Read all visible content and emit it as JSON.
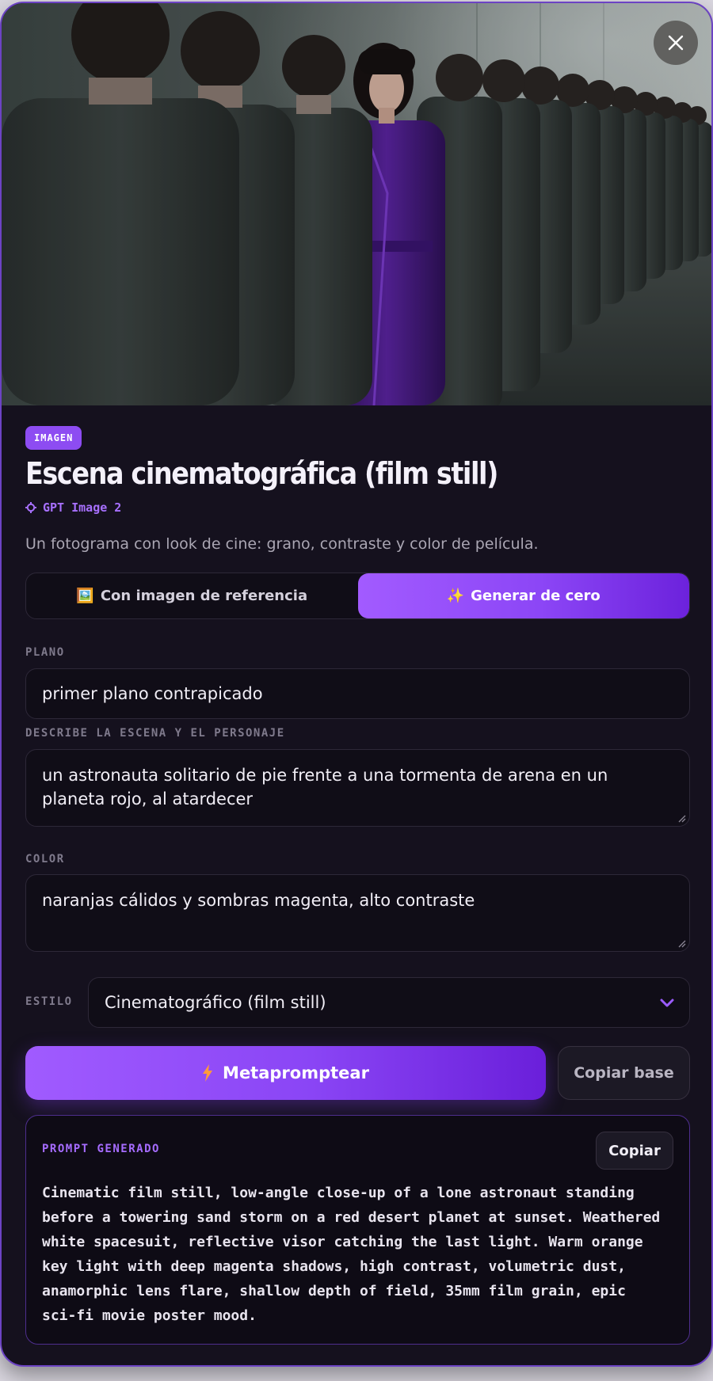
{
  "close": {
    "icon": "close-icon"
  },
  "badge": "IMAGEN",
  "title": "Escena cinematográfica (film still)",
  "model": {
    "icon": "gear-icon",
    "name": "GPT Image 2"
  },
  "description": "Un fotograma con look de cine: grano, contraste y color de película.",
  "tabs": [
    {
      "icon": "🖼️",
      "label": "Con imagen de referencia",
      "active": false
    },
    {
      "icon": "✨",
      "label": "Generar de cero",
      "active": true
    }
  ],
  "fields": {
    "plano": {
      "label": "PLANO",
      "value": "primer plano contrapicado"
    },
    "escena": {
      "label": "DESCRIBE LA ESCENA Y EL PERSONAJE",
      "value": "un astronauta solitario de pie frente a una tormenta de arena en un planeta rojo, al atardecer"
    },
    "color": {
      "label": "COLOR",
      "value": "naranjas cálidos y sombras magenta, alto contraste"
    },
    "estilo": {
      "label": "ESTILO",
      "value": "Cinematográfico (film still)"
    }
  },
  "actions": {
    "generate": "Metapromptear",
    "copy_base": "Copiar base"
  },
  "result": {
    "label": "PROMPT GENERADO",
    "copy": "Copiar",
    "text": "Cinematic film still, low-angle close-up of a lone astronaut standing before a towering sand storm on a red desert planet at sunset. Weathered white spacesuit, reflective visor catching the last light. Warm orange key light with deep magenta shadows, high contrast, volumetric dust, anamorphic lens flare, shallow depth of field, 35mm film grain, epic sci-fi movie poster mood."
  },
  "colors": {
    "accent": "#8d4cf2",
    "background": "#15111e",
    "border": "#6c43c4"
  }
}
